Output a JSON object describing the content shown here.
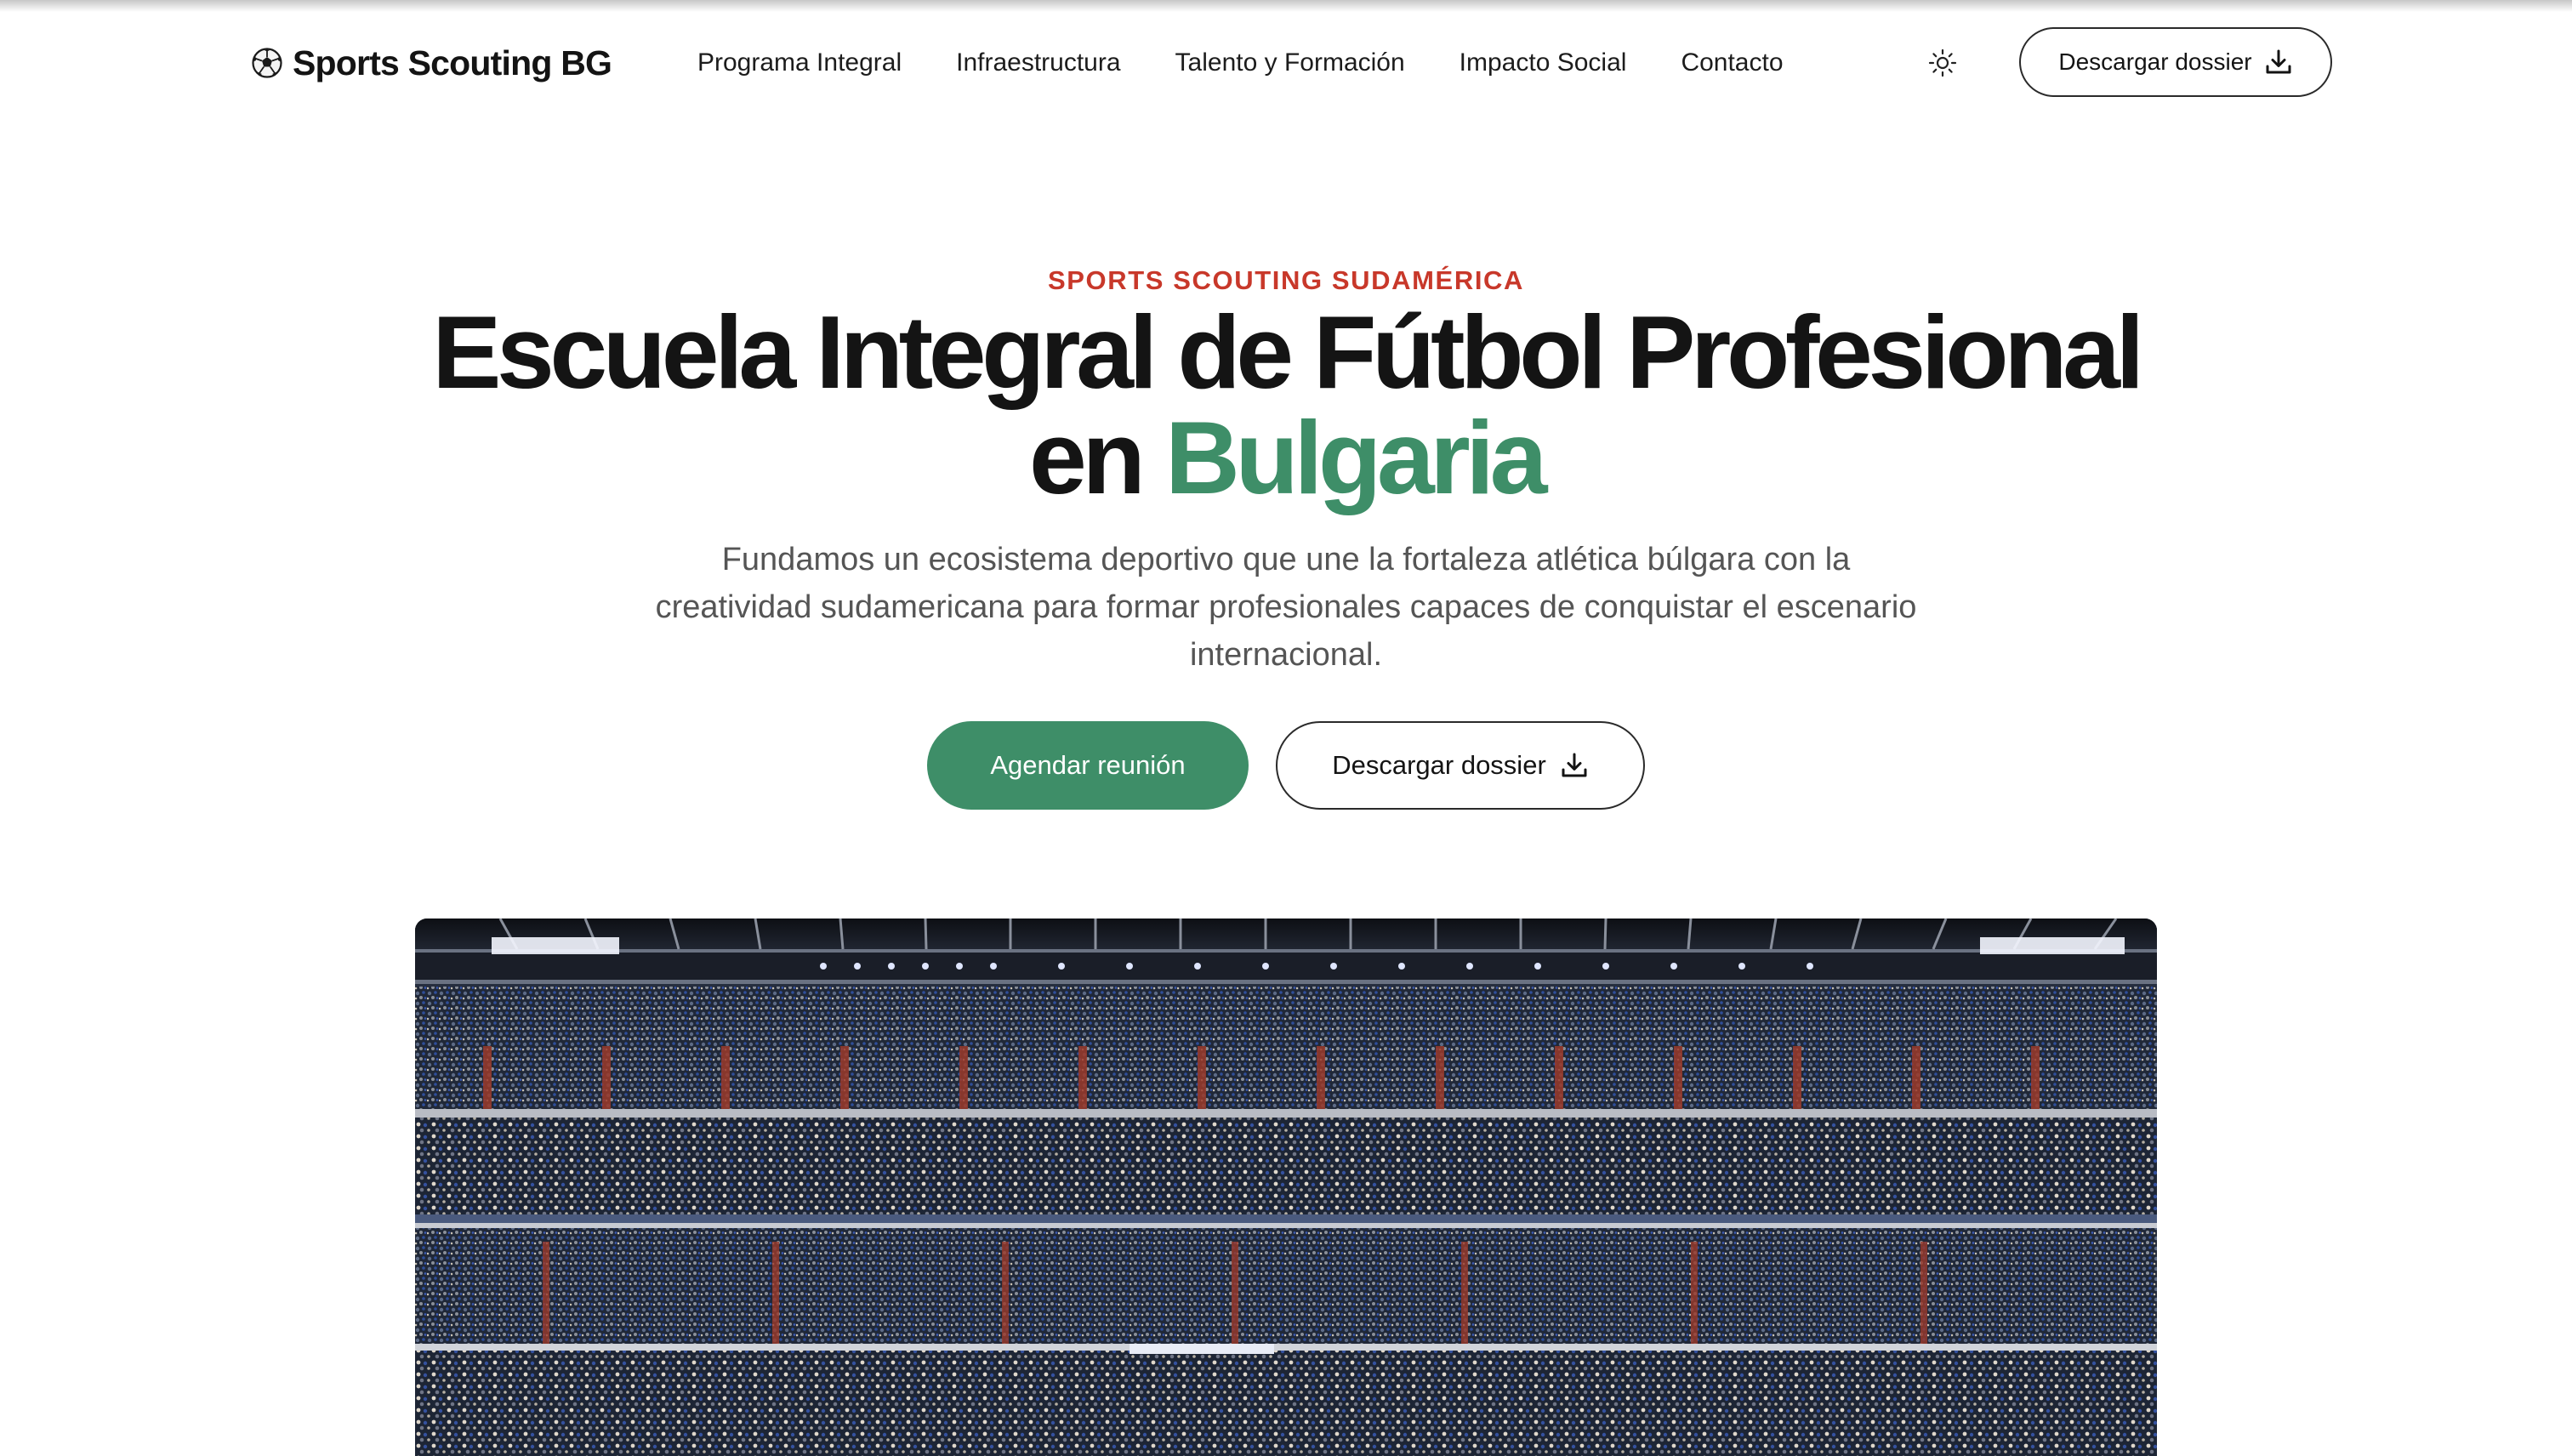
{
  "header": {
    "logo_text": "Sports Scouting BG",
    "nav": [
      {
        "label": "Programa Integral"
      },
      {
        "label": "Infraestructura"
      },
      {
        "label": "Talento y Formación"
      },
      {
        "label": "Impacto Social"
      },
      {
        "label": "Contacto"
      }
    ],
    "theme_icon": "sun-icon",
    "download_label": "Descargar dossier"
  },
  "hero": {
    "eyebrow": "SPORTS SCOUTING SUDAMÉRICA",
    "title_line1": "Escuela Integral de Fútbol Profesional",
    "title_line2_prefix": "en ",
    "title_line2_accent": "Bulgaria",
    "subtitle": "Fundamos un ecosistema deportivo que une la fortaleza atlética búlgara con la creatividad sudamericana para formar profesionales capaces de conquistar el escenario internacional.",
    "primary_cta": "Agendar reunión",
    "secondary_cta": "Descargar dossier",
    "image_icon": "stadium-photo"
  },
  "colors": {
    "accent_green": "#3e8e68",
    "eyebrow_red": "#c8382a",
    "text_dark": "#141414",
    "text_muted": "#555555"
  }
}
